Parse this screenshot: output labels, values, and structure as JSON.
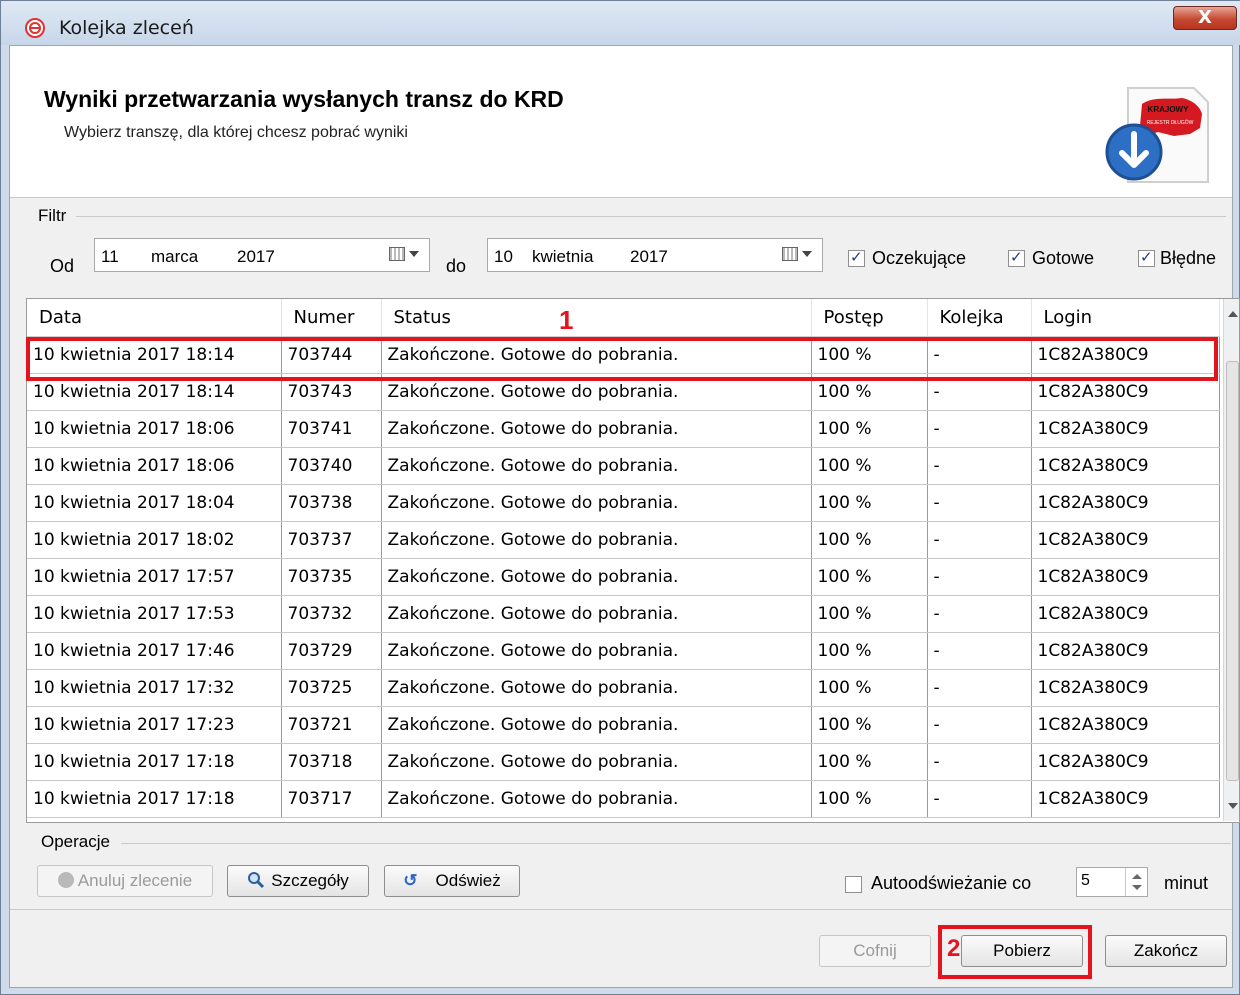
{
  "window": {
    "title": "Kolejka zleceń",
    "close_label": "X"
  },
  "header": {
    "title": "Wyniki przetwarzania wysłanych transz do KRD",
    "subtitle": "Wybierz transzę, dla której chcesz pobrać wyniki",
    "logo_text_top": "KRAJOWY",
    "logo_text_bottom": "REJESTR DŁUGÓW"
  },
  "filter": {
    "group_label": "Filtr",
    "from_label": "Od",
    "from_date": {
      "day": "11",
      "month": "marca",
      "year": "2017"
    },
    "to_label": "do",
    "to_date": {
      "day": "10",
      "month": "kwietnia",
      "year": "2017"
    },
    "checkboxes": [
      {
        "label": "Oczekujące",
        "checked": true
      },
      {
        "label": "Gotowe",
        "checked": true
      },
      {
        "label": "Błędne",
        "checked": true
      }
    ]
  },
  "table": {
    "columns": [
      "Data",
      "Numer",
      "Status",
      "Postęp",
      "Kolejka",
      "Login"
    ],
    "rows": [
      [
        "10 kwietnia 2017 18:14",
        "703744",
        "Zakończone. Gotowe do pobrania.",
        "100 %",
        "-",
        "1C82A380C9"
      ],
      [
        "10 kwietnia 2017 18:14",
        "703743",
        "Zakończone. Gotowe do pobrania.",
        "100 %",
        "-",
        "1C82A380C9"
      ],
      [
        "10 kwietnia 2017 18:06",
        "703741",
        "Zakończone. Gotowe do pobrania.",
        "100 %",
        "-",
        "1C82A380C9"
      ],
      [
        "10 kwietnia 2017 18:06",
        "703740",
        "Zakończone. Gotowe do pobrania.",
        "100 %",
        "-",
        "1C82A380C9"
      ],
      [
        "10 kwietnia 2017 18:04",
        "703738",
        "Zakończone. Gotowe do pobrania.",
        "100 %",
        "-",
        "1C82A380C9"
      ],
      [
        "10 kwietnia 2017 18:02",
        "703737",
        "Zakończone. Gotowe do pobrania.",
        "100 %",
        "-",
        "1C82A380C9"
      ],
      [
        "10 kwietnia 2017 17:57",
        "703735",
        "Zakończone. Gotowe do pobrania.",
        "100 %",
        "-",
        "1C82A380C9"
      ],
      [
        "10 kwietnia 2017 17:53",
        "703732",
        "Zakończone. Gotowe do pobrania.",
        "100 %",
        "-",
        "1C82A380C9"
      ],
      [
        "10 kwietnia 2017 17:46",
        "703729",
        "Zakończone. Gotowe do pobrania.",
        "100 %",
        "-",
        "1C82A380C9"
      ],
      [
        "10 kwietnia 2017 17:32",
        "703725",
        "Zakończone. Gotowe do pobrania.",
        "100 %",
        "-",
        "1C82A380C9"
      ],
      [
        "10 kwietnia 2017 17:23",
        "703721",
        "Zakończone. Gotowe do pobrania.",
        "100 %",
        "-",
        "1C82A380C9"
      ],
      [
        "10 kwietnia 2017 17:18",
        "703718",
        "Zakończone. Gotowe do pobrania.",
        "100 %",
        "-",
        "1C82A380C9"
      ],
      [
        "10 kwietnia 2017 17:18",
        "703717",
        "Zakończone. Gotowe do pobrania.",
        "100 %",
        "-",
        "1C82A380C9"
      ]
    ]
  },
  "annotations": {
    "marker_1": "1",
    "marker_2": "2",
    "color": "#e3141d"
  },
  "operations": {
    "group_label": "Operacje",
    "cancel_label": "Anuluj zlecenie",
    "details_label": "Szczegóły",
    "refresh_label": "Odśwież",
    "autorefresh_label": "Autoodświeżanie co",
    "autorefresh_checked": false,
    "autorefresh_value": "5",
    "minutes_label": "minut"
  },
  "footer": {
    "back_label": "Cofnij",
    "download_label": "Pobierz",
    "finish_label": "Zakończ"
  }
}
